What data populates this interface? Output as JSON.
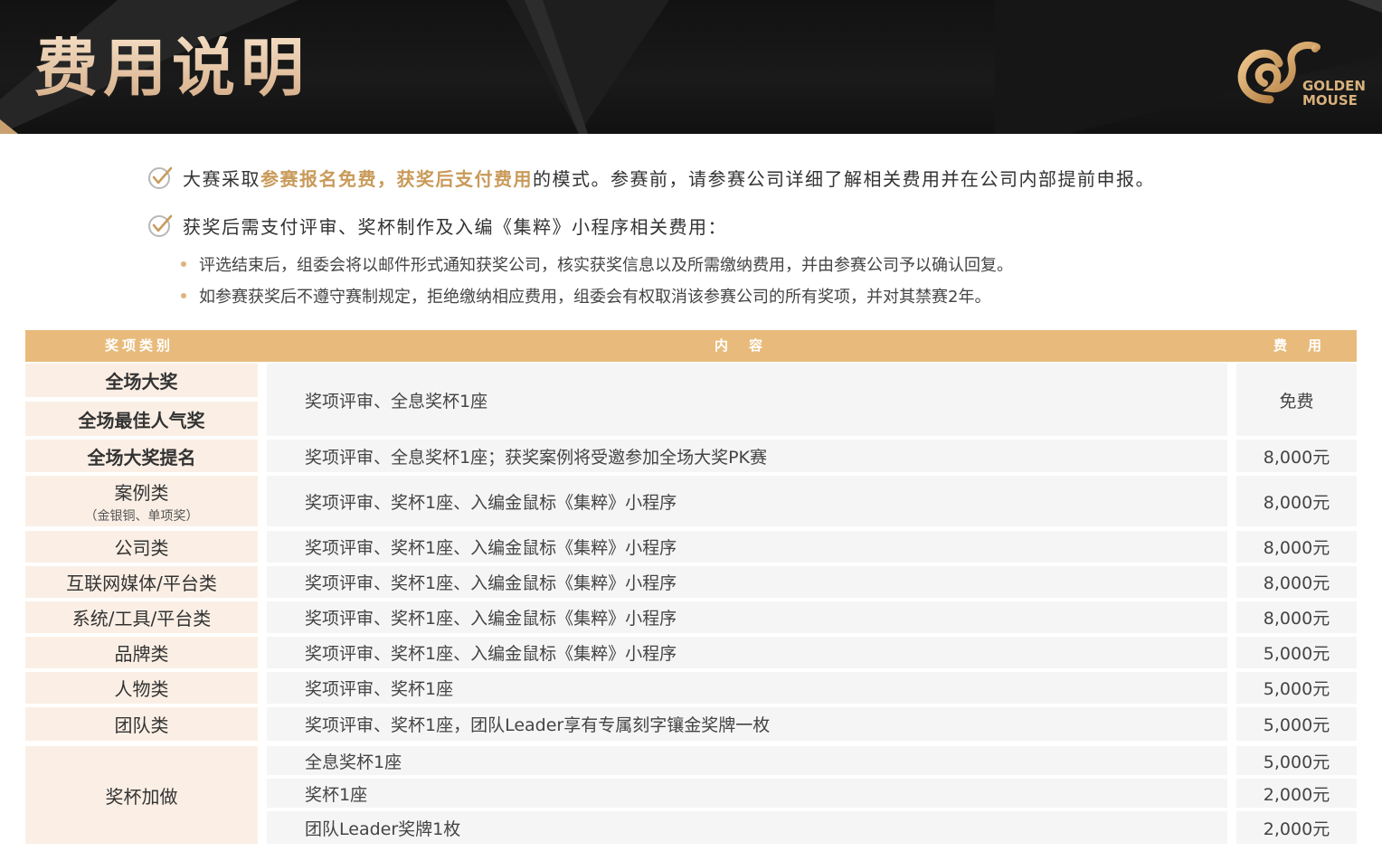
{
  "header": {
    "title": "费用说明",
    "logo_line1": "GOLDEN",
    "logo_line2": "MOUSE"
  },
  "notes": {
    "note1_pre": "大赛采取",
    "note1_highlight": "参赛报名免费，获奖后支付费用",
    "note1_post": "的模式。参赛前，请参赛公司详细了解相关费用并在公司内部提前申报。",
    "note2": "获奖后需支付评审、奖杯制作及入编《集粹》小程序相关费用：",
    "bullet1": "评选结束后，组委会将以邮件形式通知获奖公司，核实获奖信息以及所需缴纳费用，并由参赛公司予以确认回复。",
    "bullet2": "如参赛获奖后不遵守赛制规定，拒绝缴纳相应费用，组委会有权取消该参赛公司的所有奖项，并对其禁赛2年。"
  },
  "table": {
    "headers": {
      "category": "奖项类别",
      "content": "内　容",
      "fee": "费　用"
    },
    "rows": [
      {
        "category": "全场大奖",
        "category2": "全场最佳人气奖",
        "content": "奖项评审、全息奖杯1座",
        "fee": "免费"
      },
      {
        "category": "全场大奖提名",
        "content": "奖项评审、全息奖杯1座；获奖案例将受邀参加全场大奖PK赛",
        "fee": "8,000元"
      },
      {
        "category": "案例类",
        "sub": "（金银铜、单项奖）",
        "content": "奖项评审、奖杯1座、入编金鼠标《集粹》小程序",
        "fee": "8,000元"
      },
      {
        "category": "公司类",
        "content": "奖项评审、奖杯1座、入编金鼠标《集粹》小程序",
        "fee": "8,000元"
      },
      {
        "category": "互联网媒体/平台类",
        "content": "奖项评审、奖杯1座、入编金鼠标《集粹》小程序",
        "fee": "8,000元"
      },
      {
        "category": "系统/工具/平台类",
        "content": "奖项评审、奖杯1座、入编金鼠标《集粹》小程序",
        "fee": "8,000元"
      },
      {
        "category": "品牌类",
        "content": "奖项评审、奖杯1座、入编金鼠标《集粹》小程序",
        "fee": "5,000元"
      },
      {
        "category": "人物类",
        "content": "奖项评审、奖杯1座",
        "fee": "5,000元"
      },
      {
        "category": "团队类",
        "content": "奖项评审、奖杯1座，团队Leader享有专属刻字镶金奖牌一枚",
        "fee": "5,000元"
      }
    ],
    "extra": {
      "category": "奖杯加做",
      "items": [
        {
          "content": "全息奖杯1座",
          "fee": "5,000元"
        },
        {
          "content": "奖杯1座",
          "fee": "2,000元"
        },
        {
          "content": "团队Leader奖牌1枚",
          "fee": "2,000元"
        }
      ]
    }
  }
}
